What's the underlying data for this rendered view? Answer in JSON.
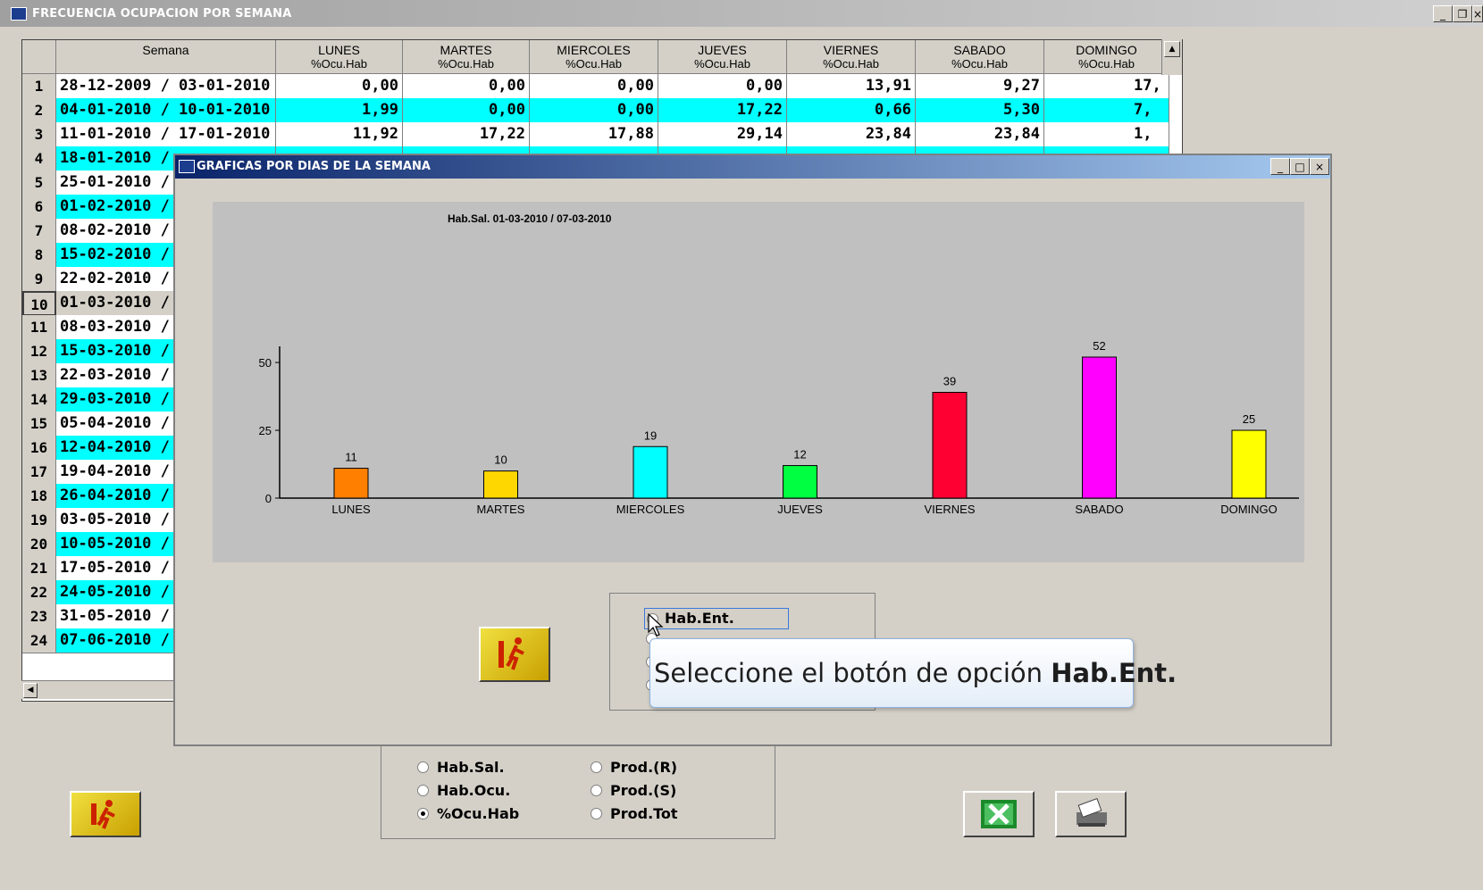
{
  "outer_window": {
    "title": "FRECUENCIA OCUPACION POR SEMANA"
  },
  "grid": {
    "columns": [
      {
        "name": "Semana",
        "sub": ""
      },
      {
        "name": "LUNES",
        "sub": "%Ocu.Hab"
      },
      {
        "name": "MARTES",
        "sub": "%Ocu.Hab"
      },
      {
        "name": "MIERCOLES",
        "sub": "%Ocu.Hab"
      },
      {
        "name": "JUEVES",
        "sub": "%Ocu.Hab"
      },
      {
        "name": "VIERNES",
        "sub": "%Ocu.Hab"
      },
      {
        "name": "SABADO",
        "sub": "%Ocu.Hab"
      },
      {
        "name": "DOMINGO",
        "sub": "%Ocu.Hab"
      }
    ],
    "rows": [
      {
        "n": "1",
        "semana": "28-12-2009 / 03-01-2010",
        "vals": [
          "0,00",
          "0,00",
          "0,00",
          "0,00",
          "13,91",
          "9,27",
          "17,"
        ],
        "highlight": false
      },
      {
        "n": "2",
        "semana": "04-01-2010 / 10-01-2010",
        "vals": [
          "1,99",
          "0,00",
          "0,00",
          "17,22",
          "0,66",
          "5,30",
          "7,"
        ],
        "highlight": true
      },
      {
        "n": "3",
        "semana": "11-01-2010 / 17-01-2010",
        "vals": [
          "11,92",
          "17,22",
          "17,88",
          "29,14",
          "23,84",
          "23,84",
          "1,"
        ],
        "highlight": false
      },
      {
        "n": "4",
        "semana": "18-01-2010 /",
        "vals": [],
        "highlight": true
      },
      {
        "n": "5",
        "semana": "25-01-2010 /",
        "vals": [],
        "highlight": false
      },
      {
        "n": "6",
        "semana": "01-02-2010 /",
        "vals": [],
        "highlight": true
      },
      {
        "n": "7",
        "semana": "08-02-2010 /",
        "vals": [],
        "highlight": false
      },
      {
        "n": "8",
        "semana": "15-02-2010 /",
        "vals": [],
        "highlight": true
      },
      {
        "n": "9",
        "semana": "22-02-2010 /",
        "vals": [],
        "highlight": false
      },
      {
        "n": "10",
        "semana": "01-03-2010 /",
        "vals": [],
        "highlight": false,
        "selected": true
      },
      {
        "n": "11",
        "semana": "08-03-2010 /",
        "vals": [],
        "highlight": false
      },
      {
        "n": "12",
        "semana": "15-03-2010 /",
        "vals": [],
        "highlight": true
      },
      {
        "n": "13",
        "semana": "22-03-2010 /",
        "vals": [],
        "highlight": false
      },
      {
        "n": "14",
        "semana": "29-03-2010 /",
        "vals": [],
        "highlight": true
      },
      {
        "n": "15",
        "semana": "05-04-2010 /",
        "vals": [],
        "highlight": false
      },
      {
        "n": "16",
        "semana": "12-04-2010 /",
        "vals": [],
        "highlight": true
      },
      {
        "n": "17",
        "semana": "19-04-2010 /",
        "vals": [],
        "highlight": false
      },
      {
        "n": "18",
        "semana": "26-04-2010 /",
        "vals": [],
        "highlight": true
      },
      {
        "n": "19",
        "semana": "03-05-2010 /",
        "vals": [],
        "highlight": false
      },
      {
        "n": "20",
        "semana": "10-05-2010 /",
        "vals": [],
        "highlight": true
      },
      {
        "n": "21",
        "semana": "17-05-2010 /",
        "vals": [],
        "highlight": false
      },
      {
        "n": "22",
        "semana": "24-05-2010 /",
        "vals": [],
        "highlight": true
      },
      {
        "n": "23",
        "semana": "31-05-2010 /",
        "vals": [],
        "highlight": false
      },
      {
        "n": "24",
        "semana": "07-06-2010 /",
        "vals": [],
        "highlight": true
      }
    ]
  },
  "inner_window": {
    "title": "GRAFICAS POR DIAS DE LA SEMANA"
  },
  "chart_data": {
    "type": "bar",
    "title": "Hab.Sal.     01-03-2010 / 07-03-2010",
    "categories": [
      "LUNES",
      "MARTES",
      "MIERCOLES",
      "JUEVES",
      "VIERNES",
      "SABADO",
      "DOMINGO"
    ],
    "values": [
      11,
      10,
      19,
      12,
      39,
      52,
      25
    ],
    "colors": [
      "#ff8000",
      "#ffd700",
      "#00ffff",
      "#00ff40",
      "#ff0033",
      "#ff00ff",
      "#ffff00"
    ],
    "yticks": [
      0,
      25,
      50
    ],
    "ylim": [
      0,
      52
    ],
    "background": "#c0c0c0"
  },
  "inner_radios": {
    "first_label": "Hab.Ent."
  },
  "tooltip": {
    "prefix": "Seleccione el botón de opción ",
    "bold": "Hab.Ent."
  },
  "bottom_radios": {
    "left": [
      {
        "label": "Hab.Sal.",
        "selected": false
      },
      {
        "label": "Hab.Ocu.",
        "selected": false
      },
      {
        "label": "%Ocu.Hab",
        "selected": true
      }
    ],
    "right": [
      {
        "label": "Prod.(R)",
        "selected": false
      },
      {
        "label": "Prod.(S)",
        "selected": false
      },
      {
        "label": "Prod.Tot",
        "selected": false
      }
    ]
  },
  "icons": {
    "exit": "exit-running-man-icon",
    "excel": "excel-icon",
    "print": "printer-icon"
  },
  "colors": {
    "row_highlight": "#00ffff",
    "row_normal": "#ffffff",
    "selected_row": "#d4d0c8"
  }
}
